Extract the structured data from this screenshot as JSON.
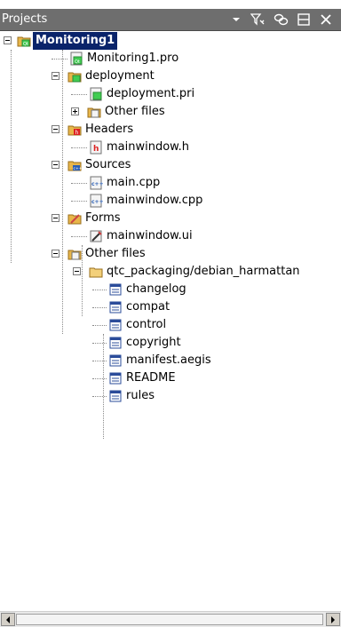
{
  "panel": {
    "title": "Projects"
  },
  "toolbar": {
    "icons": [
      "chevron-down-icon",
      "filter-icon",
      "link-icon",
      "split-icon",
      "close-icon"
    ]
  },
  "tree": {
    "root": {
      "label": "Monitoring1",
      "selected": true
    },
    "items": [
      {
        "label": "Monitoring1.pro",
        "icon": "qt-project-file-icon"
      },
      {
        "label": "deployment",
        "icon": "qt-folder-icon",
        "expanded": true
      },
      {
        "label": "deployment.pri",
        "icon": "qt-project-file-icon"
      },
      {
        "label": "Other files",
        "icon": "other-files-folder-icon",
        "expanded": false
      },
      {
        "label": "Headers",
        "icon": "headers-folder-icon",
        "expanded": true
      },
      {
        "label": "mainwindow.h",
        "icon": "header-file-icon"
      },
      {
        "label": "Sources",
        "icon": "sources-folder-icon",
        "expanded": true
      },
      {
        "label": "main.cpp",
        "icon": "cpp-file-icon"
      },
      {
        "label": "mainwindow.cpp",
        "icon": "cpp-file-icon"
      },
      {
        "label": "Forms",
        "icon": "forms-folder-icon",
        "expanded": true
      },
      {
        "label": "mainwindow.ui",
        "icon": "ui-file-icon"
      },
      {
        "label": "Other files",
        "icon": "other-files-folder-icon",
        "expanded": true
      },
      {
        "label": "qtc_packaging/debian_harmattan",
        "icon": "folder-icon",
        "expanded": true
      },
      {
        "label": "changelog",
        "icon": "text-file-icon"
      },
      {
        "label": "compat",
        "icon": "text-file-icon"
      },
      {
        "label": "control",
        "icon": "text-file-icon"
      },
      {
        "label": "copyright",
        "icon": "text-file-icon"
      },
      {
        "label": "manifest.aegis",
        "icon": "text-file-icon"
      },
      {
        "label": "README",
        "icon": "text-file-icon"
      },
      {
        "label": "rules",
        "icon": "text-file-icon"
      }
    ]
  },
  "colors": {
    "header_bg": "#6e6e6e",
    "selection_bg": "#0a246a",
    "selection_text": "#ffffff"
  }
}
